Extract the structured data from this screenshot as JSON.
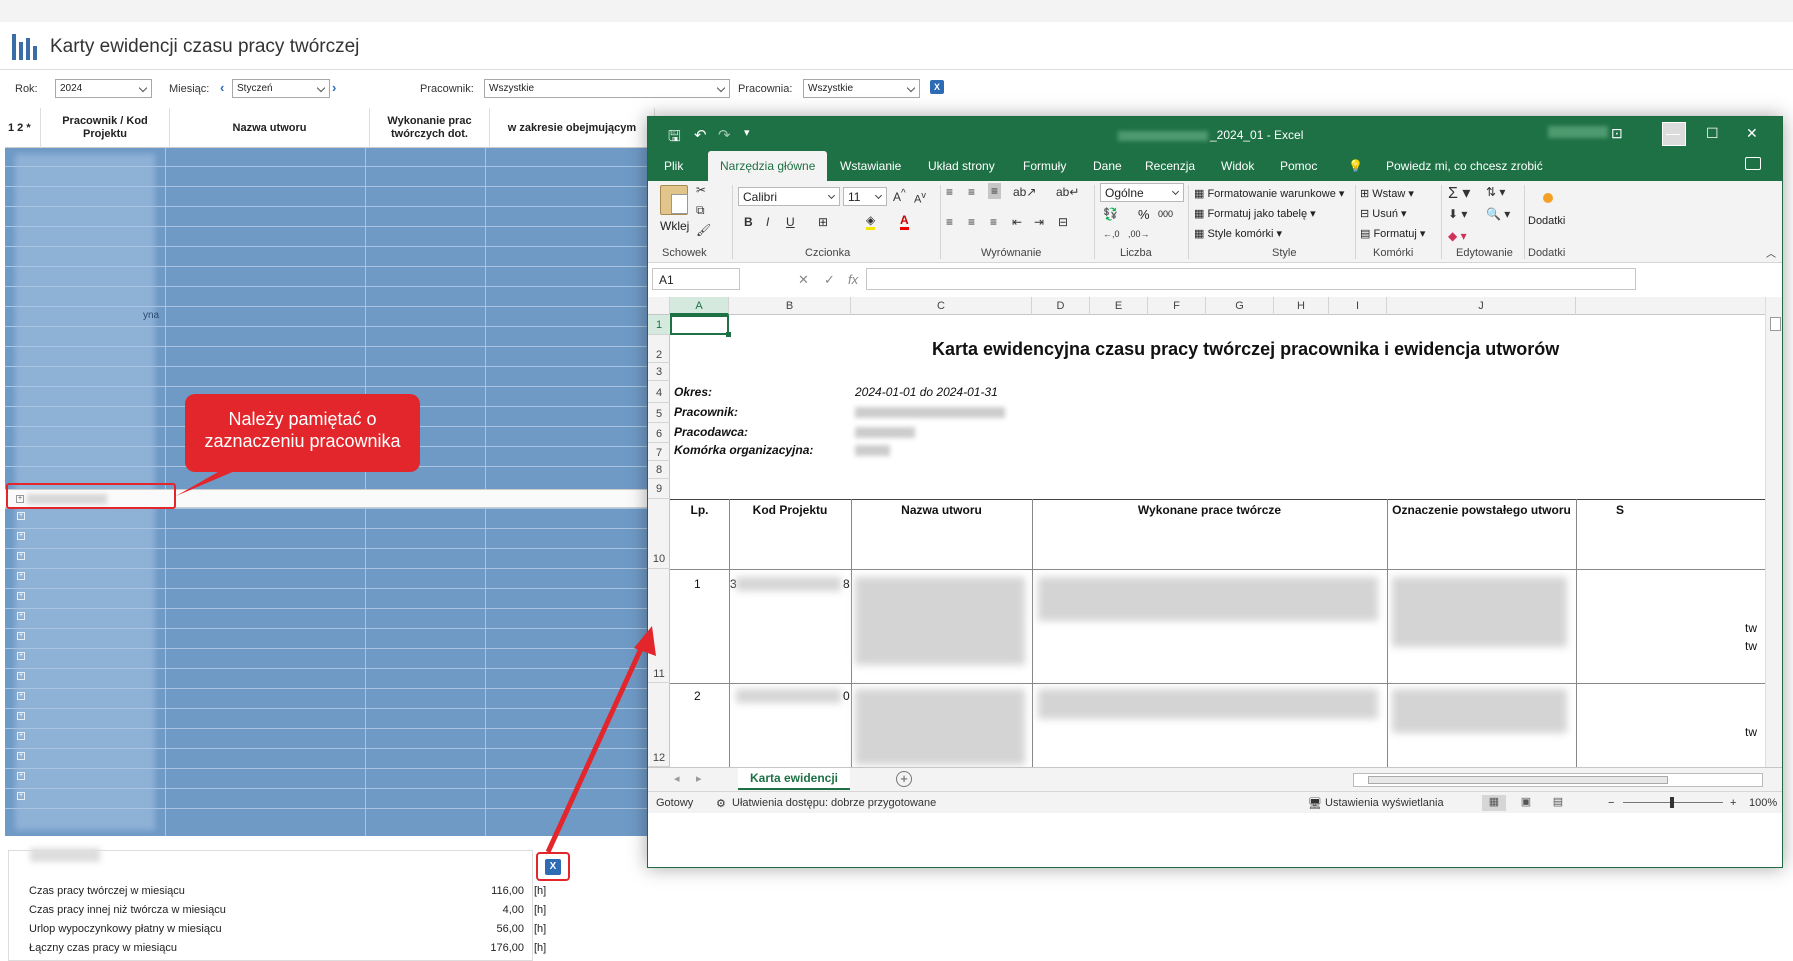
{
  "app": {
    "title": "Karty ewidencji czasu pracy twórczej"
  },
  "filters": {
    "year_label": "Rok:",
    "year_value": "2024",
    "month_label": "Miesiąc:",
    "month_value": "Styczeń",
    "employee_label": "Pracownik:",
    "employee_value": "Wszystkie",
    "position_label": "Pracownia:",
    "position_value": "Wszystkie"
  },
  "grid": {
    "levels": "1 2 *",
    "columns": [
      "Pracownik / Kod Projektu",
      "Nazwa utworu",
      "Wykonanie prac twórczych dot.",
      "w zakresie obejmującym"
    ],
    "partial_text": "yna"
  },
  "callout": {
    "text": "Należy pamiętać o zaznaczeniu pracownika"
  },
  "summary": {
    "rows": [
      {
        "label": "Czas pracy twórczej w miesiącu",
        "value": "116,00",
        "unit": "[h]"
      },
      {
        "label": "Czas pracy innej niż twórcza w miesiącu",
        "value": "4,00",
        "unit": "[h]"
      },
      {
        "label": "Urlop wypoczynkowy płatny w miesiącu",
        "value": "56,00",
        "unit": "[h]"
      },
      {
        "label": "Łączny czas pracy w miesiącu",
        "value": "176,00",
        "unit": "[h]"
      }
    ]
  },
  "excel": {
    "title_suffix": "_2024_01  -  Excel",
    "tabs": [
      "Plik",
      "Narzędzia główne",
      "Wstawianie",
      "Układ strony",
      "Formuły",
      "Dane",
      "Recenzja",
      "Widok",
      "Pomoc"
    ],
    "tell_me": "Powiedz mi, co chcesz zrobić",
    "ribbon": {
      "paste": "Wklej",
      "font_name": "Calibri",
      "font_size": "11",
      "number_format": "Ogólne",
      "percent": "%",
      "thousands": "000",
      "cond_format": "Formatowanie warunkowe",
      "as_table": "Formatuj jako tabelę",
      "cell_styles": "Style komórki",
      "insert": "Wstaw",
      "delete": "Usuń",
      "format": "Formatuj",
      "addins": "Dodatki",
      "groups": [
        "Schowek",
        "Czcionka",
        "Wyrównanie",
        "Liczba",
        "Style",
        "Komórki",
        "Edytowanie",
        "Dodatki"
      ]
    },
    "name_box": "A1",
    "columns": [
      "A",
      "B",
      "C",
      "D",
      "E",
      "F",
      "G",
      "H",
      "I",
      "J"
    ],
    "rows": [
      "1",
      "2",
      "3",
      "4",
      "5",
      "6",
      "7",
      "8",
      "9",
      "10",
      "11",
      "12"
    ],
    "sheet": {
      "title": "Karta ewidencyjna czasu pracy twórczej pracownika i ewidencja utworów",
      "period_label": "Okres:",
      "period_value": "2024-01-01 do 2024-01-31",
      "employee_label": "Pracownik:",
      "employer_label": "Pracodawca:",
      "unit_label": "Komórka organizacyjna:",
      "headers": [
        "Lp.",
        "Kod  Projektu",
        "Nazwa utworu",
        "Wykonane prace twórcze",
        "Oznaczenie powstałego utworu",
        "S"
      ],
      "lp": [
        "1",
        "2"
      ],
      "frag_b1": "3",
      "frag_b2": "8",
      "frag_c2": "0",
      "frag_k": "tw"
    },
    "sheet_tab": "Karta ewidencji",
    "status": {
      "ready": "Gotowy",
      "accessibility": "Ułatwienia dostępu: dobrze przygotowane",
      "display": "Ustawienia wyświetlania",
      "zoom": "100%"
    }
  }
}
